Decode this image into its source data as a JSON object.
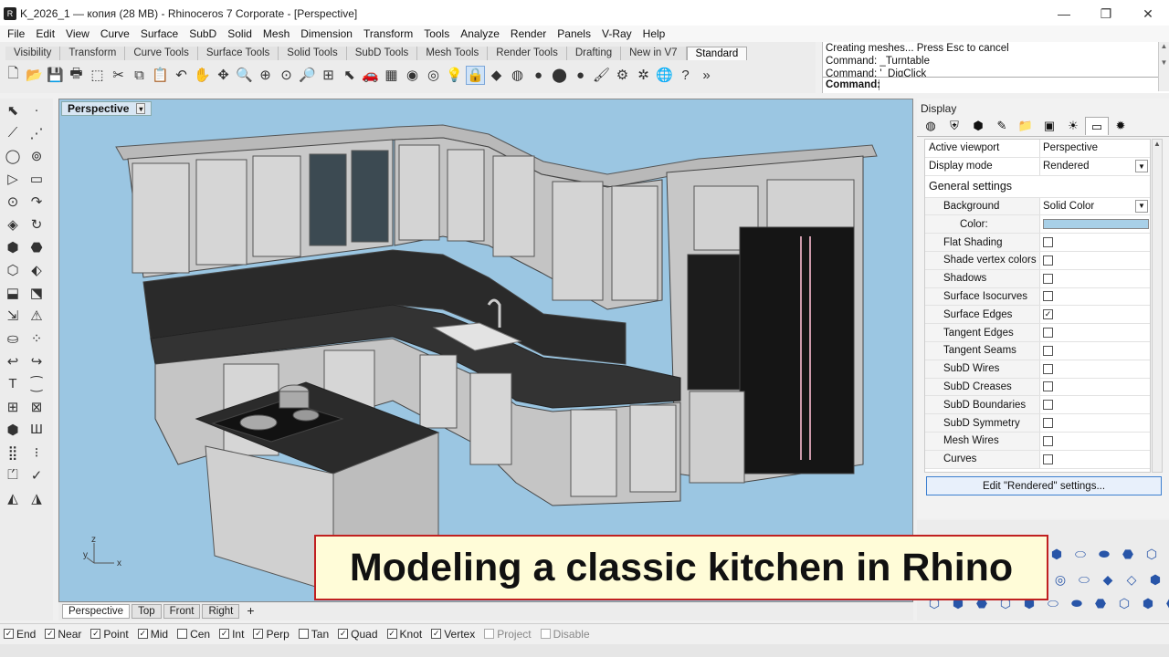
{
  "window": {
    "title": "K_2026_1 — копия (28 MB) - Rhinoceros 7 Corporate - [Perspective]",
    "minimize": "—",
    "restore": "❐",
    "close": "✕"
  },
  "menu": [
    "File",
    "Edit",
    "View",
    "Curve",
    "Surface",
    "SubD",
    "Solid",
    "Mesh",
    "Dimension",
    "Transform",
    "Tools",
    "Analyze",
    "Render",
    "Panels",
    "V-Ray",
    "Help"
  ],
  "toolbar_tabs": [
    "Visibility",
    "Transform",
    "Curve Tools",
    "Surface Tools",
    "Solid Tools",
    "SubD Tools",
    "Mesh Tools",
    "Render Tools",
    "Drafting",
    "New in V7",
    "Standard"
  ],
  "toolbar_active_tab": "Standard",
  "toolbar_icons": [
    {
      "name": "new-icon",
      "glyph": "🗋"
    },
    {
      "name": "open-icon",
      "glyph": "📂"
    },
    {
      "name": "save-icon",
      "glyph": "💾"
    },
    {
      "name": "print-icon",
      "glyph": "🖶"
    },
    {
      "name": "import-icon",
      "glyph": "⬚"
    },
    {
      "name": "cut-icon",
      "glyph": "✂"
    },
    {
      "name": "copy-icon",
      "glyph": "⧉"
    },
    {
      "name": "paste-icon",
      "glyph": "📋"
    },
    {
      "name": "undo-icon",
      "glyph": "↶"
    },
    {
      "name": "pan-icon",
      "glyph": "✋"
    },
    {
      "name": "rotate-view-icon",
      "glyph": "✥"
    },
    {
      "name": "zoom-icon",
      "glyph": "🔍"
    },
    {
      "name": "zoom-window-icon",
      "glyph": "⊕"
    },
    {
      "name": "zoom-extents-icon",
      "glyph": "⊙"
    },
    {
      "name": "zoom-selected-icon",
      "glyph": "🔎"
    },
    {
      "name": "four-views-icon",
      "glyph": "⊞"
    },
    {
      "name": "select-icon",
      "glyph": "⬉"
    },
    {
      "name": "car-icon",
      "glyph": "🚗"
    },
    {
      "name": "grid-icon",
      "glyph": "▦"
    },
    {
      "name": "hide-icon",
      "glyph": "◉"
    },
    {
      "name": "show-icon",
      "glyph": "◎"
    },
    {
      "name": "light-icon",
      "glyph": "💡"
    },
    {
      "name": "lock-icon",
      "glyph": "🔒"
    },
    {
      "name": "layer-icon",
      "glyph": "◆"
    },
    {
      "name": "color-wheel-icon",
      "glyph": "◍"
    },
    {
      "name": "shaded-sphere-icon",
      "glyph": "●"
    },
    {
      "name": "rendered-sphere-icon",
      "glyph": "⬤"
    },
    {
      "name": "blue-sphere-icon",
      "glyph": "●"
    },
    {
      "name": "paint-icon",
      "glyph": "🖌"
    },
    {
      "name": "options-icon",
      "glyph": "⚙"
    },
    {
      "name": "grasshopper-icon",
      "glyph": "✲"
    },
    {
      "name": "globe-icon",
      "glyph": "🌐"
    },
    {
      "name": "help-icon",
      "glyph": "?"
    },
    {
      "name": "more-icon",
      "glyph": "»"
    }
  ],
  "command_history": [
    "Creating meshes... Press Esc to cancel",
    "Command: _Turntable",
    "Command: '_DigClick"
  ],
  "command_prompt_label": "Command:",
  "left_palette_icons": [
    "⬉",
    "·",
    "⟋",
    "⋰",
    "◯",
    "⊚",
    "▷",
    "▭",
    "⊙",
    "↷",
    "◈",
    "↻",
    "⬢",
    "⬣",
    "⬡",
    "⬖",
    "⬓",
    "⬔",
    "⇲",
    "⚠",
    "⛀",
    "⁘",
    "↩",
    "↪",
    "T",
    "⁐",
    "⊞",
    "⊠",
    "⬢",
    "Ш",
    "⣿",
    "⁝",
    "⏍",
    "✓",
    "◭",
    "◮"
  ],
  "viewport": {
    "label": "Perspective",
    "dropdown": "▾",
    "axis_x": "x",
    "axis_y": "y",
    "axis_z": "z"
  },
  "viewport_tabs": [
    "Perspective",
    "Top",
    "Front",
    "Right"
  ],
  "viewport_tab_add": "+",
  "osnaps": [
    {
      "label": "End",
      "checked": true
    },
    {
      "label": "Near",
      "checked": true
    },
    {
      "label": "Point",
      "checked": true
    },
    {
      "label": "Mid",
      "checked": true
    },
    {
      "label": "Cen",
      "checked": false
    },
    {
      "label": "Int",
      "checked": true
    },
    {
      "label": "Perp",
      "checked": true
    },
    {
      "label": "Tan",
      "checked": false
    },
    {
      "label": "Quad",
      "checked": true
    },
    {
      "label": "Knot",
      "checked": true
    },
    {
      "label": "Vertex",
      "checked": true
    },
    {
      "label": "Project",
      "checked": false
    },
    {
      "label": "Disable",
      "checked": false
    }
  ],
  "display_panel": {
    "title": "Display",
    "tab_icons": [
      "◍",
      "⛨",
      "⬢",
      "✎",
      "📁",
      "▣",
      "☀",
      "▭",
      "✹"
    ],
    "active_viewport_label": "Active viewport",
    "active_viewport_value": "Perspective",
    "display_mode_label": "Display mode",
    "display_mode_value": "Rendered",
    "general_settings_label": "General settings",
    "background_label": "Background",
    "background_value": "Solid Color",
    "color_label": "Color:",
    "background_color": "#a8d0e8",
    "options": [
      {
        "label": "Flat Shading",
        "checked": false
      },
      {
        "label": "Shade vertex colors",
        "checked": false
      },
      {
        "label": "Shadows",
        "checked": false
      },
      {
        "label": "Surface Isocurves",
        "checked": false
      },
      {
        "label": "Surface Edges",
        "checked": true
      },
      {
        "label": "Tangent Edges",
        "checked": false
      },
      {
        "label": "Tangent Seams",
        "checked": false
      },
      {
        "label": "SubD Wires",
        "checked": false
      },
      {
        "label": "SubD Creases",
        "checked": false
      },
      {
        "label": "SubD Boundaries",
        "checked": false
      },
      {
        "label": "SubD Symmetry",
        "checked": false
      },
      {
        "label": "Mesh Wires",
        "checked": false
      },
      {
        "label": "Curves",
        "checked": false
      }
    ],
    "edit_button": "Edit \"Rendered\" settings..."
  },
  "right_lower_icons": [
    "⬢",
    "⬭",
    "⬬",
    "⬣",
    "⬡",
    "⬢",
    "◎",
    "⬭",
    "◆",
    "◇",
    "⬢",
    "⬣",
    "⬡",
    "⬢",
    "⬣",
    "⬡",
    "⬢",
    "⬭",
    "⬬",
    "⬣",
    "⬡",
    "⬢",
    "⬣",
    "⬡"
  ],
  "banner_text": "Modeling a classic kitchen in Rhino",
  "colors": {
    "viewport_bg": "#9bc6e2",
    "banner_bg": "#fffcd8",
    "banner_border": "#c02020"
  }
}
